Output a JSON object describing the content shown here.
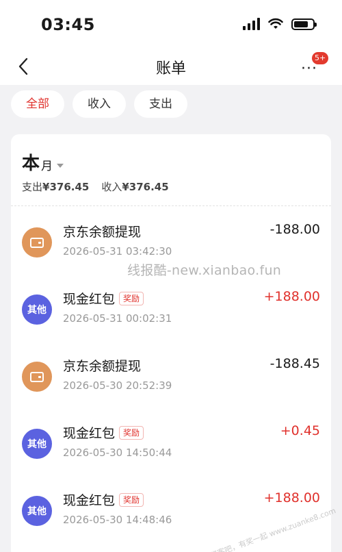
{
  "status": {
    "time": "03:45"
  },
  "nav": {
    "title": "账单",
    "badge": "5+",
    "more": "···"
  },
  "filters": [
    {
      "label": "全部",
      "active": true
    },
    {
      "label": "收入",
      "active": false
    },
    {
      "label": "支出",
      "active": false
    }
  ],
  "summary": {
    "month_big": "本",
    "month_small": "月",
    "expense_label": "支出",
    "expense": "¥376.45",
    "income_label": "收入",
    "income": "¥376.45"
  },
  "transactions": [
    {
      "name": "京东余额提现",
      "tag": "",
      "time": "2026-05-31 03:42:30",
      "amount": "-188.00",
      "type": "out",
      "icon": "wallet-icon"
    },
    {
      "name": "现金红包",
      "tag": "奖励",
      "time": "2026-05-31 00:02:31",
      "amount": "+188.00",
      "type": "in",
      "icon": "其他"
    },
    {
      "name": "京东余额提现",
      "tag": "",
      "time": "2026-05-30 20:52:39",
      "amount": "-188.45",
      "type": "out",
      "icon": "wallet-icon"
    },
    {
      "name": "现金红包",
      "tag": "奖励",
      "time": "2026-05-30 14:50:44",
      "amount": "+0.45",
      "type": "in",
      "icon": "其他"
    },
    {
      "name": "现金红包",
      "tag": "奖励",
      "time": "2026-05-30 14:48:46",
      "amount": "+188.00",
      "type": "in",
      "icon": "其他"
    }
  ],
  "watermark": "线报酷-new.xianbao.fun",
  "corner_watermark": "赚客吧，有奖一起 www.zuanke8.com",
  "colors": {
    "accent": "#e0312c",
    "wallet": "#e0965a",
    "other": "#5b62e0"
  }
}
